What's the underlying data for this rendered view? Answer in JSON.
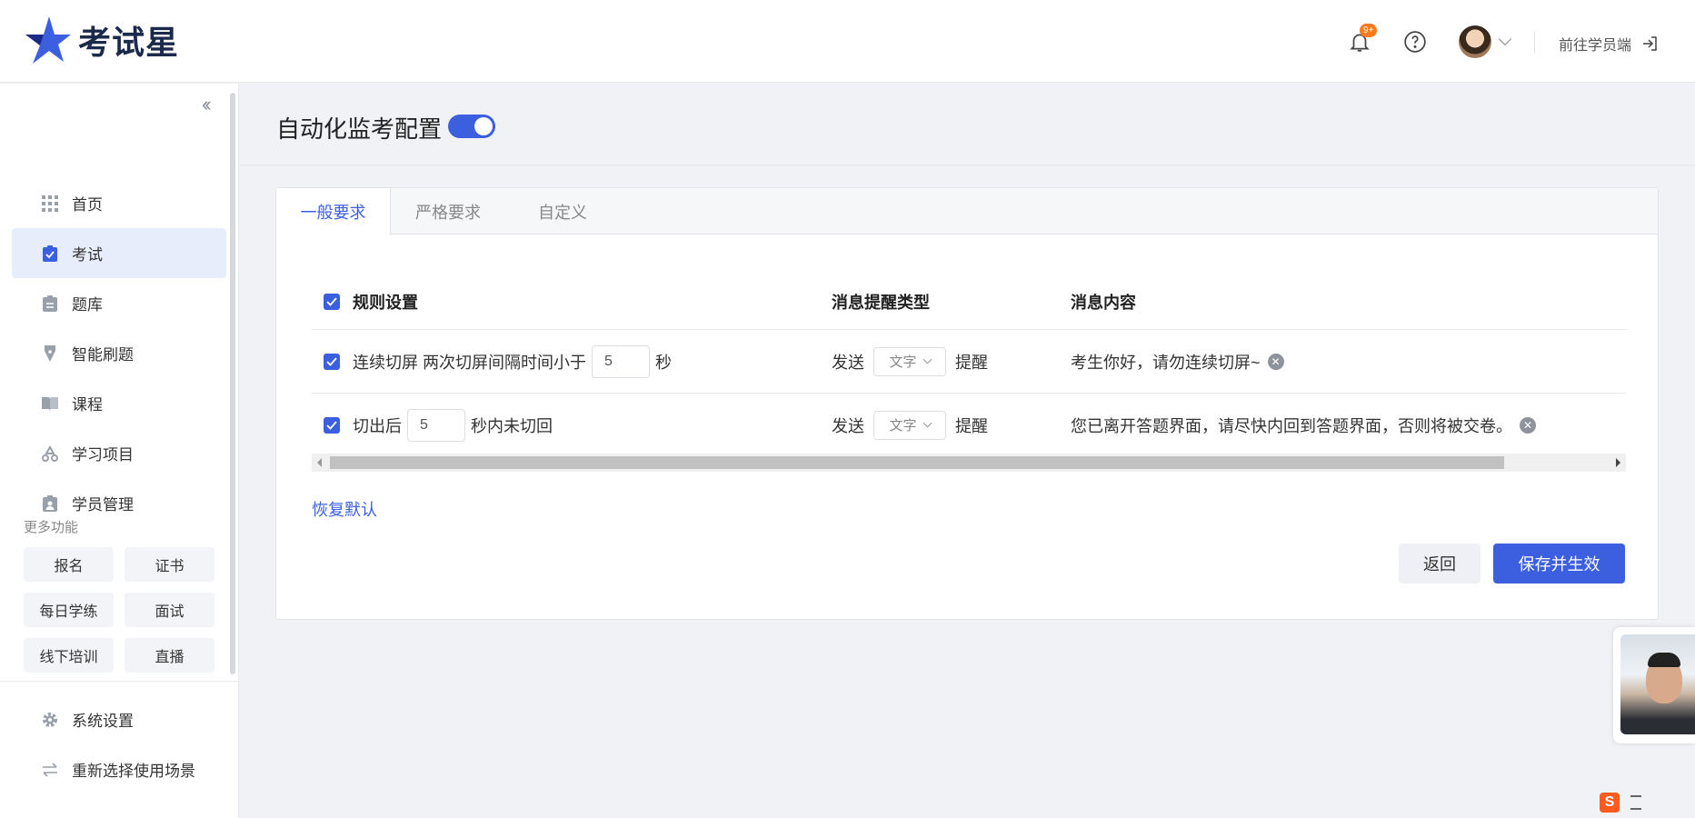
{
  "brand": {
    "name": "考试星",
    "accent": "#3c5fe0"
  },
  "header": {
    "notification_badge": "9+",
    "student_link": "前往学员端"
  },
  "sidebar": {
    "items": [
      {
        "label": "首页",
        "icon": "grid-icon",
        "active": false
      },
      {
        "label": "考试",
        "icon": "clipboard-check-icon",
        "active": true
      },
      {
        "label": "题库",
        "icon": "document-icon",
        "active": false
      },
      {
        "label": "智能刷题",
        "icon": "pen-nib-icon",
        "active": false
      },
      {
        "label": "课程",
        "icon": "book-icon",
        "active": false
      },
      {
        "label": "学习项目",
        "icon": "recycle-icon",
        "active": false
      },
      {
        "label": "学员管理",
        "icon": "id-badge-icon",
        "active": false
      }
    ],
    "more_title": "更多功能",
    "quick_links": [
      "报名",
      "证书",
      "每日学练",
      "面试",
      "线下培训",
      "直播"
    ],
    "bottom_items": [
      {
        "label": "系统设置",
        "icon": "gear-icon"
      },
      {
        "label": "重新选择使用场景",
        "icon": "swap-icon"
      }
    ]
  },
  "page": {
    "title": "自动化监考配置",
    "toggle_on": true,
    "tabs": [
      "一般要求",
      "严格要求",
      "自定义"
    ],
    "active_tab": 0
  },
  "table": {
    "headers": {
      "rule": "规则设置",
      "type": "消息提醒类型",
      "content": "消息内容"
    },
    "rows": [
      {
        "checked": true,
        "rule_prefix": "连续切屏 两次切屏间隔时间小于",
        "value": "5",
        "rule_suffix": "秒",
        "send": "发送",
        "type": "文字",
        "remind": "提醒",
        "message": "考生你好，请勿连续切屏~"
      },
      {
        "checked": true,
        "rule_prefix": "切出后",
        "value": "5",
        "rule_suffix": "秒内未切回",
        "send": "发送",
        "type": "文字",
        "remind": "提醒",
        "message": "您已离开答题界面，请尽快内回到答题界面，否则将被交卷。"
      }
    ]
  },
  "actions": {
    "restore": "恢复默认",
    "back": "返回",
    "save": "保存并生效"
  }
}
